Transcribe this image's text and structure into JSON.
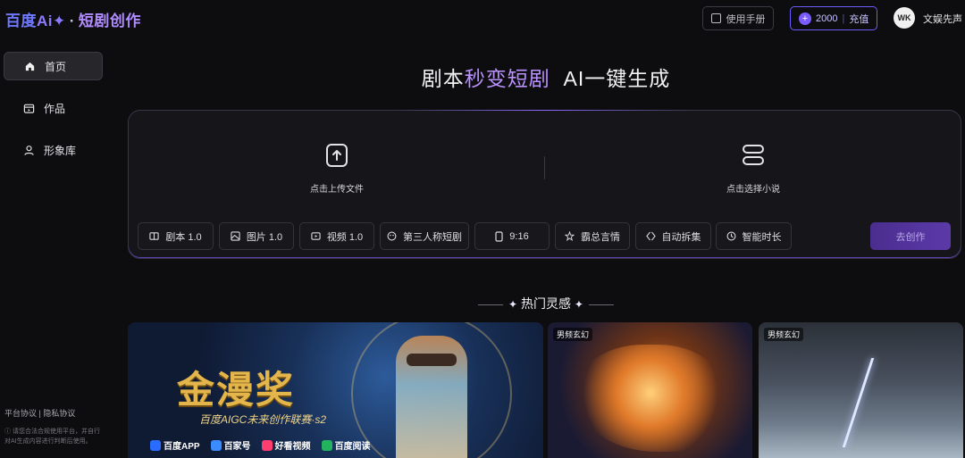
{
  "header": {
    "logo_brand": "百度",
    "logo_ai": "Ai✦",
    "logo_sep": "·",
    "logo_product": "短剧创作",
    "manual_label": "使用手册",
    "balance": "2000",
    "recharge_label": "充值",
    "avatar_text": "WK",
    "username": "文娱先声"
  },
  "sidebar": {
    "items": [
      {
        "label": "首页",
        "icon": "home-icon"
      },
      {
        "label": "作品",
        "icon": "works-icon"
      },
      {
        "label": "形象库",
        "icon": "user-icon"
      }
    ],
    "footer_links": "平台协议 | 隐私协议",
    "footer_note": "ⓘ 请您合法合规使用平台，并自行对AI生成内容进行判断后使用。"
  },
  "main": {
    "headline_pre": "剧本",
    "headline_highlight": "秒变短剧",
    "headline_post": "AI一键生成",
    "upload_label": "点击上传文件",
    "pick_label": "点击选择小说",
    "chips": [
      {
        "label": "剧本 1.0",
        "icon": "script-icon"
      },
      {
        "label": "图片 1.0",
        "icon": "image-icon"
      },
      {
        "label": "视频 1.0",
        "icon": "video-icon"
      },
      {
        "label": "第三人称短剧",
        "icon": "mask-icon"
      },
      {
        "label": "9:16",
        "icon": "phone-ratio-icon"
      },
      {
        "label": "霸总言情",
        "icon": "genre-icon"
      },
      {
        "label": "自动拆集",
        "icon": "split-icon"
      },
      {
        "label": "智能时长",
        "icon": "clock-icon"
      }
    ],
    "create_label": "去创作",
    "section_title": "热门灵感",
    "cards": [
      {
        "title": "金漫奖",
        "subtitle": "百度AIGC未来创作联赛·s2",
        "brands": [
          "百度APP",
          "百家号",
          "好看视频",
          "百度阅读"
        ]
      },
      {
        "tag": "男频玄幻"
      },
      {
        "tag": "男频玄幻"
      }
    ]
  },
  "colors": {
    "accent": "#8b6bff",
    "highlight": "#b992ff",
    "background": "#0d0d0f"
  }
}
